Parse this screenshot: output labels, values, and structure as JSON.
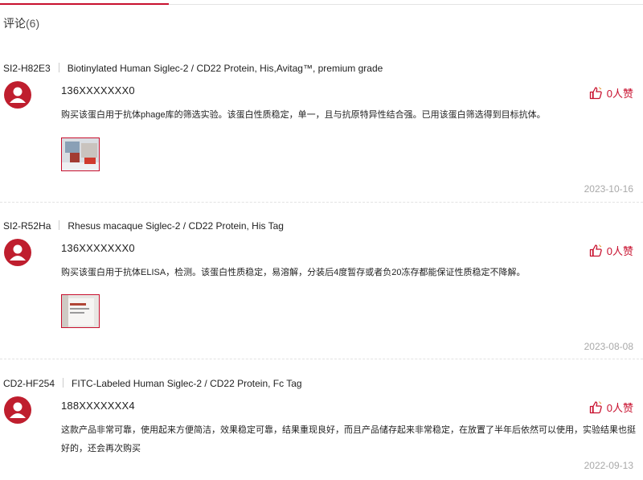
{
  "section": {
    "title": "评论",
    "count": "(6)"
  },
  "reviews": [
    {
      "sku": "SI2-H82E3",
      "product": "Biotinylated Human Siglec-2 / CD22 Protein, His,Avitag™, premium grade",
      "user": "136XXXXXXX0",
      "likes": "0人赞",
      "text": "购买该蛋白用于抗体phage库的筛选实验。该蛋白性质稳定，单一，且与抗原特异性结合强。已用该蛋白筛选得到目标抗体。",
      "date": "2023-10-16",
      "has_image": true
    },
    {
      "sku": "SI2-R52Ha",
      "product": "Rhesus macaque Siglec-2 / CD22 Protein, His Tag",
      "user": "136XXXXXXX0",
      "likes": "0人赞",
      "text": "购买该蛋白用于抗体ELISA，检测。该蛋白性质稳定，易溶解，分装后4度暂存或者负20冻存都能保证性质稳定不降解。",
      "date": "2023-08-08",
      "has_image": true
    },
    {
      "sku": "CD2-HF254",
      "product": "FITC-Labeled Human Siglec-2 / CD22 Protein, Fc Tag",
      "user": "188XXXXXXX4",
      "likes": "0人赞",
      "text": "这款产品非常可靠，使用起来方便简洁，效果稳定可靠，结果重现良好，而且产品储存起来非常稳定，在放置了半年后依然可以使用，实验结果也挺好的，还会再次购买",
      "date": "2022-09-13",
      "has_image": false
    }
  ],
  "colors": {
    "accent": "#c8102e",
    "date": "#a9a9a9"
  },
  "icons": {
    "avatar": "user-avatar-icon",
    "like": "thumbs-up-icon"
  }
}
